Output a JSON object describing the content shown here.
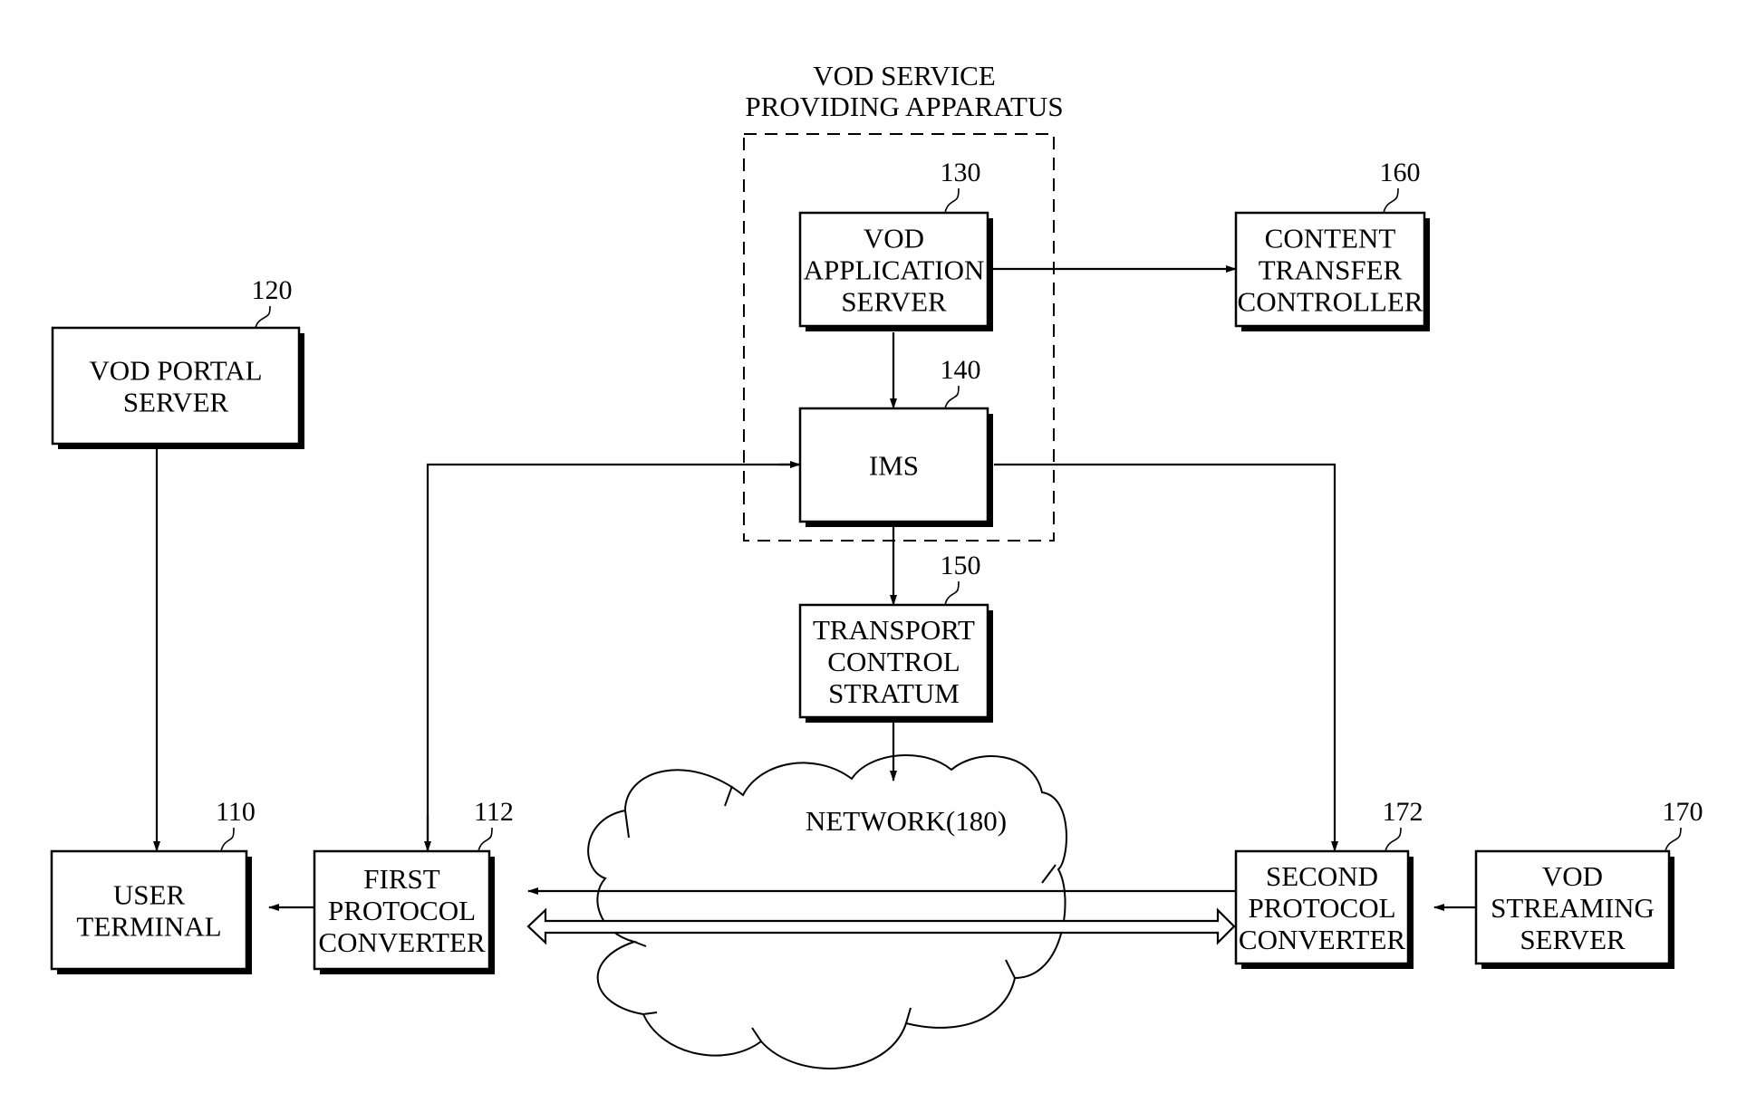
{
  "diagram": {
    "apparatus_label": [
      "VOD SERVICE",
      "PROVIDING APPARATUS"
    ],
    "nodes": {
      "vod_portal_server": {
        "ref": "120",
        "lines": [
          "VOD PORTAL",
          "SERVER"
        ]
      },
      "vod_application_server": {
        "ref": "130",
        "lines": [
          "VOD",
          "APPLICATION",
          "SERVER"
        ]
      },
      "ims": {
        "ref": "140",
        "lines": [
          "IMS"
        ]
      },
      "transport_control_stratum": {
        "ref": "150",
        "lines": [
          "TRANSPORT",
          "CONTROL",
          "STRATUM"
        ]
      },
      "content_transfer_controller": {
        "ref": "160",
        "lines": [
          "CONTENT",
          "TRANSFER",
          "CONTROLLER"
        ]
      },
      "user_terminal": {
        "ref": "110",
        "lines": [
          "USER",
          "TERMINAL"
        ]
      },
      "first_protocol_converter": {
        "ref": "112",
        "lines": [
          "FIRST",
          "PROTOCOL",
          "CONVERTER"
        ]
      },
      "second_protocol_converter": {
        "ref": "172",
        "lines": [
          "SECOND",
          "PROTOCOL",
          "CONVERTER"
        ]
      },
      "vod_streaming_server": {
        "ref": "170",
        "lines": [
          "VOD",
          "STREAMING",
          "SERVER"
        ]
      }
    },
    "network": {
      "label": "NETWORK(180)"
    },
    "edges": [
      {
        "from": "vod_application_server",
        "to": "content_transfer_controller",
        "type": "arrow"
      },
      {
        "from": "vod_application_server",
        "to": "ims",
        "type": "arrow"
      },
      {
        "from": "ims",
        "to": "transport_control_stratum",
        "type": "arrow"
      },
      {
        "from": "transport_control_stratum",
        "to": "network",
        "type": "arrow"
      },
      {
        "from": "vod_portal_server",
        "to": "user_terminal",
        "type": "arrow"
      },
      {
        "from": "first_protocol_converter",
        "to": "ims",
        "type": "arrow",
        "note": "IMS to FPC and FPC to IMS lines"
      },
      {
        "from": "ims",
        "to": "second_protocol_converter",
        "type": "arrow"
      },
      {
        "from": "user_terminal",
        "to": "first_protocol_converter",
        "type": "bidirectional"
      },
      {
        "from": "second_protocol_converter",
        "to": "first_protocol_converter",
        "type": "arrow",
        "note": "thin signaling arrow"
      },
      {
        "from": "first_protocol_converter",
        "to": "second_protocol_converter",
        "type": "hollow-bidirectional",
        "note": "media stream"
      },
      {
        "from": "second_protocol_converter",
        "to": "vod_streaming_server",
        "type": "bidirectional"
      }
    ]
  }
}
